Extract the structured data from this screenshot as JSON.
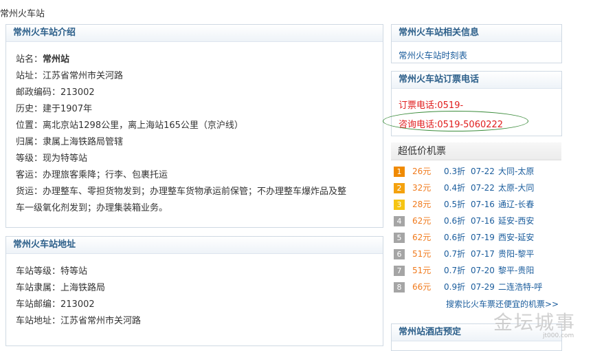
{
  "breadcrumb": "常州火车站",
  "intro": {
    "title": "常州火车站介绍",
    "items": [
      {
        "label": "站名：",
        "value": "常州站"
      },
      {
        "label": "站址：",
        "value": "江苏省常州市关河路"
      },
      {
        "label": "邮政编码：",
        "value": "213002"
      },
      {
        "label": "历史：",
        "value": "建于1907年"
      },
      {
        "label": "位置：",
        "value": "离北京站1298公里，离上海站165公里（京沪线）"
      },
      {
        "label": "归属：",
        "value": "隶属上海铁路局管辖"
      },
      {
        "label": "等级：",
        "value": "现为特等站"
      },
      {
        "label": "客运：",
        "value": "办理旅客乘降；行李、包裹托运"
      },
      {
        "label": "货运：",
        "value": "办理整车、零担货物发到；办理整车货物承运前保管；不办理整车爆炸品及整"
      },
      {
        "label": "",
        "value": "车一级氧化剂发到；办理集装箱业务。"
      }
    ]
  },
  "address": {
    "title": "常州火车站地址",
    "items": [
      {
        "label": "车站等级：",
        "value": "特等站"
      },
      {
        "label": "车站隶属：",
        "value": "上海铁路局"
      },
      {
        "label": "车站邮编：",
        "value": "213002"
      },
      {
        "label": "车站地址：",
        "value": "江苏省常州市关河路"
      }
    ]
  },
  "related": {
    "title": "常州火车站相关信息",
    "link": "常州火车站时刻表"
  },
  "phone": {
    "title": "常州火车站订票电话",
    "booking": "订票电话:0519-",
    "inquiry": "咨询电话:0519-5060222"
  },
  "tickets": {
    "title": "超低价机票",
    "rows": [
      {
        "rank": "1",
        "price": "26元",
        "discount": "0.3折",
        "date": "07-22",
        "route": "大同-太原"
      },
      {
        "rank": "2",
        "price": "32元",
        "discount": "0.4折",
        "date": "07-22",
        "route": "太原-大同"
      },
      {
        "rank": "3",
        "price": "28元",
        "discount": "0.5折",
        "date": "07-16",
        "route": "通辽-长春"
      },
      {
        "rank": "4",
        "price": "62元",
        "discount": "0.6折",
        "date": "07-16",
        "route": "延安-西安"
      },
      {
        "rank": "5",
        "price": "62元",
        "discount": "0.6折",
        "date": "07-19",
        "route": "西安-延安"
      },
      {
        "rank": "6",
        "price": "51元",
        "discount": "0.7折",
        "date": "07-17",
        "route": "贵阳-黎平"
      },
      {
        "rank": "7",
        "price": "51元",
        "discount": "0.7折",
        "date": "07-20",
        "route": "黎平-贵阳"
      },
      {
        "rank": "8",
        "price": "66元",
        "discount": "0.9折",
        "date": "07-29",
        "route": "二连浩特-呼"
      }
    ],
    "more": "搜索比火车票还便宜的机票>>"
  },
  "hotel": {
    "title": "常州站酒店预定"
  },
  "watermark": {
    "text": "金坛城事",
    "sub": "jt000.com"
  }
}
